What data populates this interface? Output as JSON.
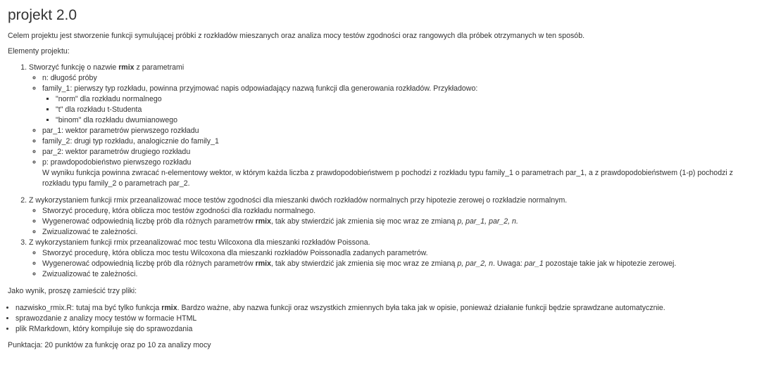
{
  "title": "projekt 2.0",
  "intro": "Celem projektu jest stworzenie funkcji symulującej próbki z rozkładów mieszanych oraz analiza mocy testów zgodności oraz rangowych dla próbek otrzymanych w ten sposób.",
  "elements_heading": "Elementy projektu:",
  "task1": {
    "pre": "Stworzyć funkcję o nazwie ",
    "bold": "rmix",
    "post": " z parametrami",
    "params": {
      "n": "n: długość próby",
      "family_1": "family_1: pierwszy typ rozkładu, powinna przyjmować napis odpowiadający nazwą funkcji dla generowania rozkładów. Przykładowo:",
      "examples": [
        "\"norm\" dla rozkładu normalnego",
        "\"t\" dla rozkładu t-Studenta",
        "\"binom\" dla rozkładu dwumianowego"
      ],
      "par_1": "par_1: wektor parametrów pierwszego rozkładu",
      "family_2": "family_2: drugi typ rozkładu, analogicznie do family_1",
      "par_2": "par_2: wektor parametrów drugiego rozkładu",
      "p": "p: prawdopodobieństwo pierwszego rozkładu",
      "p_note": "W wyniku funkcja powinna zwracać n-elementowy wektor, w którym każda liczba z prawdopodobieństwem p pochodzi z rozkładu typu family_1 o parametrach par_1, a z prawdopodobieństwem (1-p) pochodzi z rozkładu typu family_2 o parametrach par_2."
    }
  },
  "task2": {
    "text": "Z wykorzystaniem funkcji rmix przeanalizować moce testów zgodności dla mieszanki dwóch rozkładów normalnych przy hipotezie zerowej o rozkładzie normalnym.",
    "item1": "Stworzyć procedurę, która oblicza moc testów zgodności dla rozkładu normalnego.",
    "item2_pre": "Wygenerować odpowiednią liczbę prób dla różnych parametrów ",
    "item2_bold": "rmix",
    "item2_mid": ", tak aby stwierdzić jak zmienia się moc wraz ze zmianą ",
    "item2_italic": "p, par_1, par_2, n.",
    "item3": "Zwizualizować te zależności."
  },
  "task3": {
    "text": "Z wykorzystaniem funkcji rmix przeanalizować moc testu Wilcoxona dla mieszanki rozkładów Poissona.",
    "item1": "Stworzyć procedurę, która oblicza moc testu Wilcoxona dla mieszanki rozkładów Poissonadla zadanych parametrów.",
    "item2_pre": "Wygenerować odpowiednią liczbę prób dla różnych parametrów ",
    "item2_bold": "rmix",
    "item2_mid": ", tak aby stwierdzić jak zmienia się moc wraz ze zmianą ",
    "item2_italic": "p, par_2, n",
    "item2_mid2": ". Uwaga: ",
    "item2_italic2": "par_1",
    "item2_post": " pozostaje takie jak w hipotezie zerowej.",
    "item3": "Zwizualizować te zależności."
  },
  "result_heading": "Jako wynik, proszę zamieścić trzy pliki:",
  "files": {
    "f1_pre": "nazwisko_rmix.R: tutaj ma być tylko funkcja ",
    "f1_bold": "rmix",
    "f1_post": ". Bardzo ważne, aby nazwa funkcji oraz wszystkich zmiennych była taka jak w opisie, ponieważ działanie funkcji będzie sprawdzane automatycznie.",
    "f2": "sprawozdanie z analizy mocy testów w formacie HTML",
    "f3": "plik RMarkdown, który kompiluje się do sprawozdania"
  },
  "scoring": "Punktacja: 20 punktów za funkcję oraz po 10 za analizy mocy"
}
